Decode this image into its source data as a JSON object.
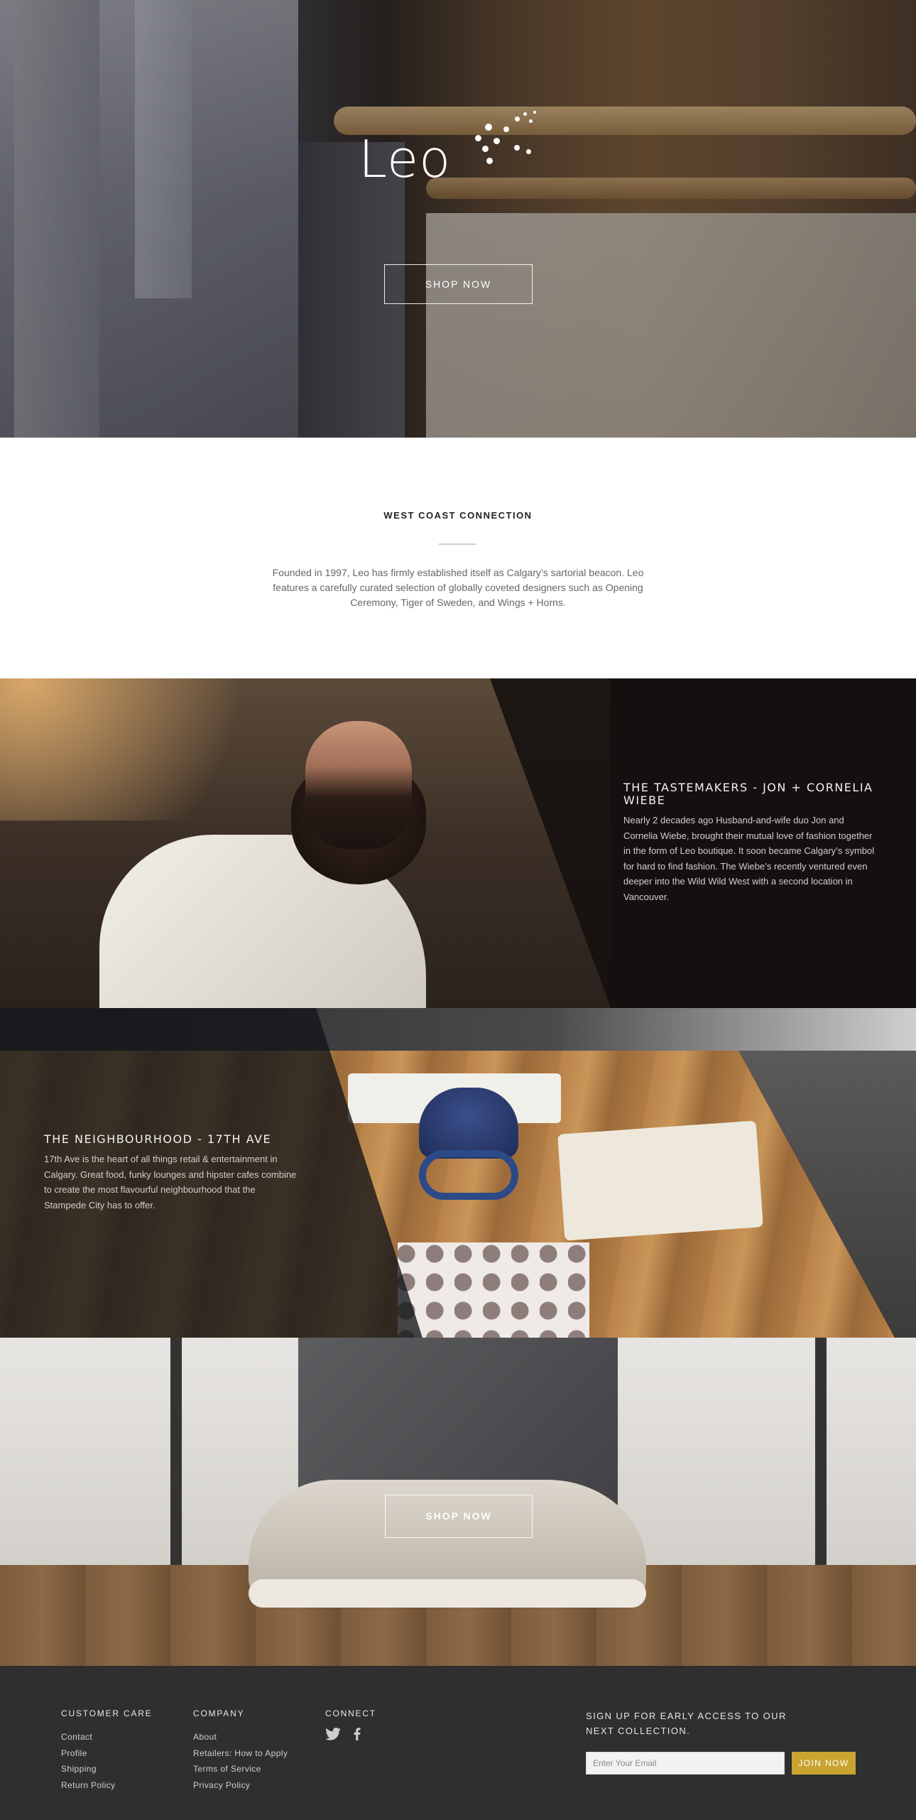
{
  "hero": {
    "brand": "Leo",
    "cta_label": "SHOP NOW"
  },
  "intro": {
    "heading": "WEST COAST CONNECTION",
    "body": "Founded in 1997, Leo has firmly established itself as Calgary’s sartorial beacon. Leo features a carefully curated selection of globally coveted designers such as Opening Ceremony, Tiger of Sweden, and Wings + Horns."
  },
  "tastemakers": {
    "heading": "THE TASTEMAKERS - JON + CORNELIA WIEBE",
    "body": "Nearly 2 decades ago Husband-and-wife duo Jon and Cornelia Wiebe, brought their mutual love of fashion together in the form of Leo boutique. It soon became Calgary’s symbol for hard to find fashion. The Wiebe’s recently ventured even deeper into the Wild Wild West with a second location in Vancouver."
  },
  "neighbourhood": {
    "heading": "THE NEIGHBOURHOOD - 17TH AVE",
    "body": "17th Ave is the heart of all things retail & entertainment in Calgary. Great food, funky lounges and hipster cafes combine to create the most flavourful neighbourhood that the Stampede City has to offer."
  },
  "promo": {
    "cta_label": "SHOP NOW"
  },
  "footer": {
    "customer_care": {
      "heading": "CUSTOMER CARE",
      "links": [
        "Contact",
        "Profile",
        "Shipping",
        "Return Policy"
      ]
    },
    "company": {
      "heading": "COMPANY",
      "links": [
        "About",
        "Retailers: How to Apply",
        "Terms of Service",
        "Privacy Policy"
      ]
    },
    "connect": {
      "heading": "CONNECT",
      "icons": [
        "twitter-icon",
        "facebook-icon"
      ]
    },
    "signup": {
      "lead": "SIGN UP FOR EARLY ACCESS TO OUR NEXT COLLECTION.",
      "placeholder": "Enter Your Email",
      "button_label": "JOIN NOW"
    }
  },
  "colors": {
    "footer_bg": "#2f2f2f",
    "accent_gold": "#c9a431"
  }
}
